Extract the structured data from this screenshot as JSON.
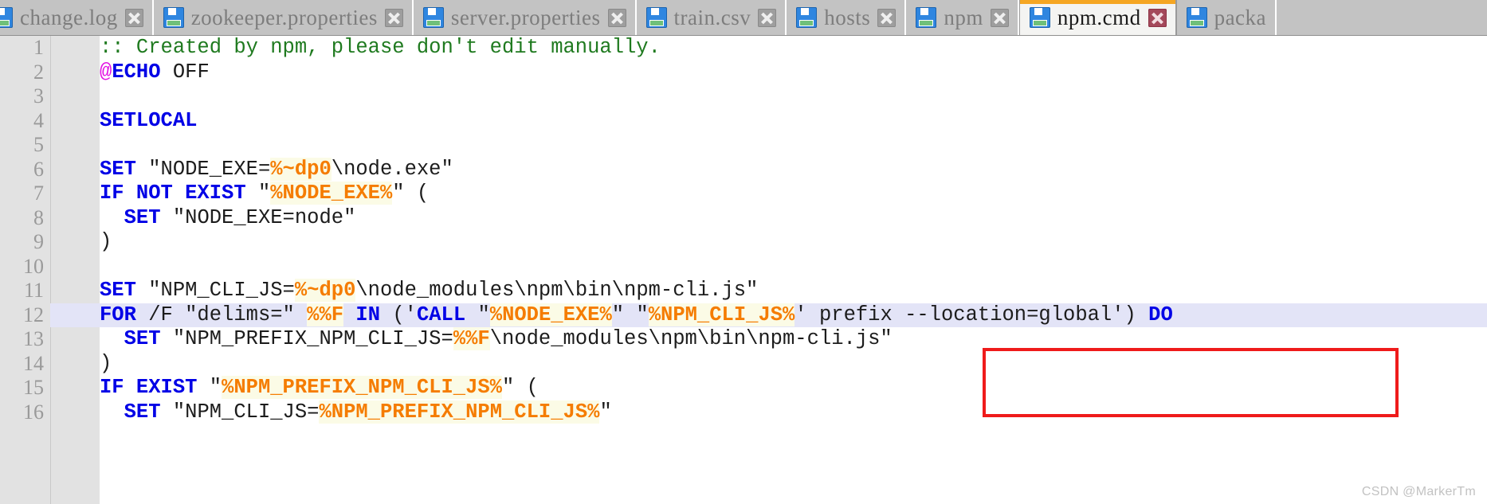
{
  "window": {
    "active_file": "npm.cmd",
    "watermark": "CSDN @MarkerTm"
  },
  "tabbar": {
    "icon_name": "floppy-save-icon",
    "close_icon_name": "close-icon",
    "tabs": [
      {
        "label": "change.log",
        "active": false,
        "truncated_left": true
      },
      {
        "label": "zookeeper.properties",
        "active": false
      },
      {
        "label": "server.properties",
        "active": false
      },
      {
        "label": "train.csv",
        "active": false
      },
      {
        "label": "hosts",
        "active": false
      },
      {
        "label": "npm",
        "active": false
      },
      {
        "label": "npm.cmd",
        "active": true
      },
      {
        "label": "packa",
        "active": false,
        "truncated_right": true
      }
    ]
  },
  "editor": {
    "current_line": 12,
    "colors": {
      "keyword": "#0000e6",
      "comment": "#1f7a1f",
      "variable": "#f57c00",
      "variable_bg": "#fbfbe6",
      "plain": "#1c1c1c",
      "at_sign": "#e312e3",
      "current_line_bg": "#e3e4f7",
      "gutter_bg": "#e2e2e2",
      "gutter_fg": "#9a9a9a",
      "tab_bar_bg": "#c3c3c3",
      "active_tab_bg": "#f4f4f2",
      "active_tab_accent": "#f5a623",
      "annotation_box": "#ef1b1b"
    },
    "lines": [
      {
        "n": "1",
        "tokens": [
          {
            "t": ":: Created by npm, please don't edit manually.",
            "c": "comment"
          }
        ]
      },
      {
        "n": "2",
        "tokens": [
          {
            "t": "@",
            "c": "at"
          },
          {
            "t": "ECHO",
            "c": "kw"
          },
          {
            "t": " OFF",
            "c": "plain"
          }
        ]
      },
      {
        "n": "3",
        "tokens": []
      },
      {
        "n": "4",
        "tokens": [
          {
            "t": "SETLOCAL",
            "c": "kw"
          }
        ]
      },
      {
        "n": "5",
        "tokens": []
      },
      {
        "n": "6",
        "tokens": [
          {
            "t": "SET",
            "c": "kw"
          },
          {
            "t": " \"NODE_EXE=",
            "c": "plain"
          },
          {
            "t": "%~dp0",
            "c": "var"
          },
          {
            "t": "\\node.exe\"",
            "c": "plain"
          }
        ]
      },
      {
        "n": "7",
        "tokens": [
          {
            "t": "IF NOT EXIST",
            "c": "kw"
          },
          {
            "t": " \"",
            "c": "plain"
          },
          {
            "t": "%NODE_EXE%",
            "c": "var"
          },
          {
            "t": "\" (",
            "c": "plain"
          }
        ]
      },
      {
        "n": "8",
        "tokens": [
          {
            "t": "  ",
            "c": "plain"
          },
          {
            "t": "SET",
            "c": "kw"
          },
          {
            "t": " \"NODE_EXE=node\"",
            "c": "plain"
          }
        ]
      },
      {
        "n": "9",
        "tokens": [
          {
            "t": ")",
            "c": "plain"
          }
        ]
      },
      {
        "n": "10",
        "tokens": []
      },
      {
        "n": "11",
        "tokens": [
          {
            "t": "SET",
            "c": "kw"
          },
          {
            "t": " \"NPM_CLI_JS=",
            "c": "plain"
          },
          {
            "t": "%~dp0",
            "c": "var"
          },
          {
            "t": "\\node_modules\\npm\\bin\\npm-cli.js\"",
            "c": "plain"
          }
        ]
      },
      {
        "n": "12",
        "tokens": [
          {
            "t": "FOR",
            "c": "kw"
          },
          {
            "t": " /F \"delims=\" ",
            "c": "plain"
          },
          {
            "t": "%%F",
            "c": "var"
          },
          {
            "t": " ",
            "c": "plain"
          },
          {
            "t": "IN",
            "c": "kw"
          },
          {
            "t": " ('",
            "c": "plain"
          },
          {
            "t": "CALL",
            "c": "kw"
          },
          {
            "t": " \"",
            "c": "plain"
          },
          {
            "t": "%NODE_EXE%",
            "c": "var"
          },
          {
            "t": "\" \"",
            "c": "plain"
          },
          {
            "t": "%NPM_CLI_JS%",
            "c": "var"
          },
          {
            "t": "' prefix --location=global') ",
            "c": "plain"
          },
          {
            "t": "DO",
            "c": "kw"
          }
        ]
      },
      {
        "n": "13",
        "tokens": [
          {
            "t": "  ",
            "c": "plain"
          },
          {
            "t": "SET",
            "c": "kw"
          },
          {
            "t": " \"NPM_PREFIX_NPM_CLI_JS=",
            "c": "plain"
          },
          {
            "t": "%%F",
            "c": "var"
          },
          {
            "t": "\\node_modules\\npm\\bin\\npm-cli.js\"",
            "c": "plain"
          }
        ]
      },
      {
        "n": "14",
        "tokens": [
          {
            "t": ")",
            "c": "plain"
          }
        ]
      },
      {
        "n": "15",
        "tokens": [
          {
            "t": "IF EXIST",
            "c": "kw"
          },
          {
            "t": " \"",
            "c": "plain"
          },
          {
            "t": "%NPM_PREFIX_NPM_CLI_JS%",
            "c": "var"
          },
          {
            "t": "\" (",
            "c": "plain"
          }
        ]
      },
      {
        "n": "16",
        "tokens": [
          {
            "t": "  ",
            "c": "plain"
          },
          {
            "t": "SET",
            "c": "kw"
          },
          {
            "t": " \"NPM_CLI_JS=",
            "c": "plain"
          },
          {
            "t": "%NPM_PREFIX_NPM_CLI_JS%",
            "c": "var"
          },
          {
            "t": "\"",
            "c": "plain"
          }
        ]
      }
    ]
  },
  "annotation": {
    "name": "red-highlight-box",
    "targets_text": "' prefix --location=global')"
  }
}
